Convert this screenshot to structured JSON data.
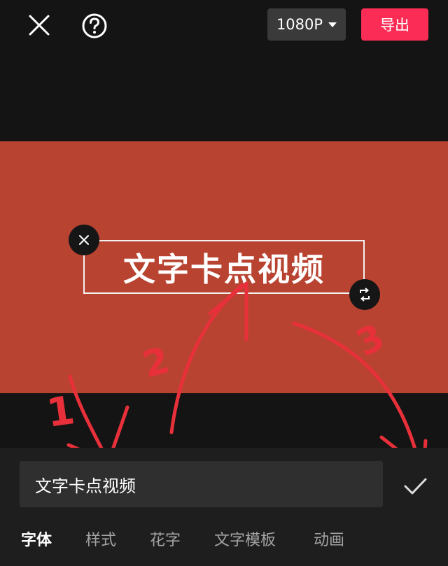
{
  "header": {
    "resolution_label": "1080P",
    "export_label": "导出"
  },
  "canvas": {
    "background_color": "#b84331",
    "overlay_text": "文字卡点视频"
  },
  "annotations": {
    "step_1": "1",
    "step_2": "2",
    "step_3": "3",
    "color": "#e8303a"
  },
  "editor": {
    "input_value": "文字卡点视频"
  },
  "tabs": [
    {
      "label": "字体",
      "active": true
    },
    {
      "label": "样式",
      "active": false
    },
    {
      "label": "花字",
      "active": false
    },
    {
      "label": "文字模板",
      "active": false
    },
    {
      "label": "动画",
      "active": false
    }
  ],
  "colors": {
    "accent": "#fb2c55",
    "background": "#141414"
  }
}
